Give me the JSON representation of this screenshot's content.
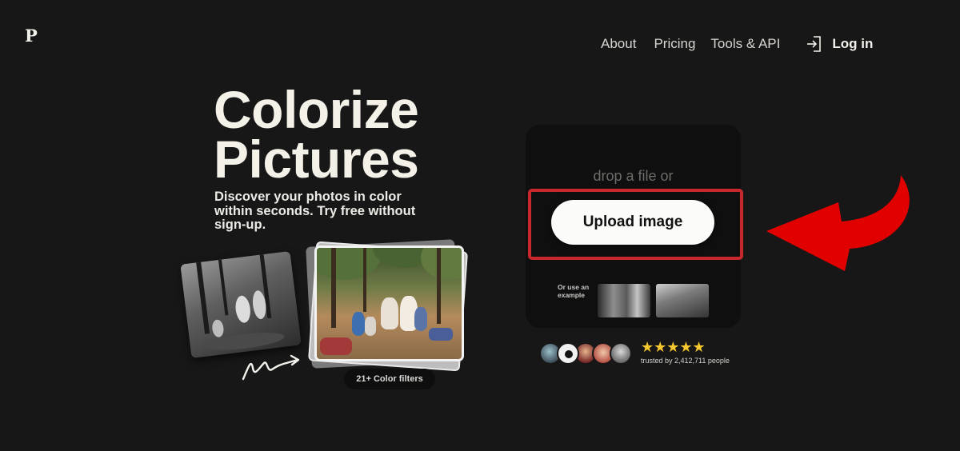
{
  "brand": {
    "logo": "P"
  },
  "nav": {
    "about": "About",
    "pricing": "Pricing",
    "tools": "Tools & API",
    "login": "Log in"
  },
  "hero": {
    "title_line1": "Colorize",
    "title_line2": "Pictures",
    "subtitle_line1": "Discover your photos in color",
    "subtitle_line2": "within seconds. Try free without",
    "subtitle_line3": "sign-up.",
    "filters_pill": "21+ Color filters"
  },
  "upload": {
    "drop_text": "drop a file or",
    "button_label": "Upload image",
    "example_label_line1": "Or use an",
    "example_label_line2": "example"
  },
  "social_proof": {
    "stars": "★★★★★",
    "trusted_text": "trusted by 2,412,711 people"
  },
  "colors": {
    "background": "#181717",
    "panel": "#0f0f0f",
    "highlight": "#c8282c",
    "arrow": "#e00000",
    "star": "#f7c92f"
  }
}
